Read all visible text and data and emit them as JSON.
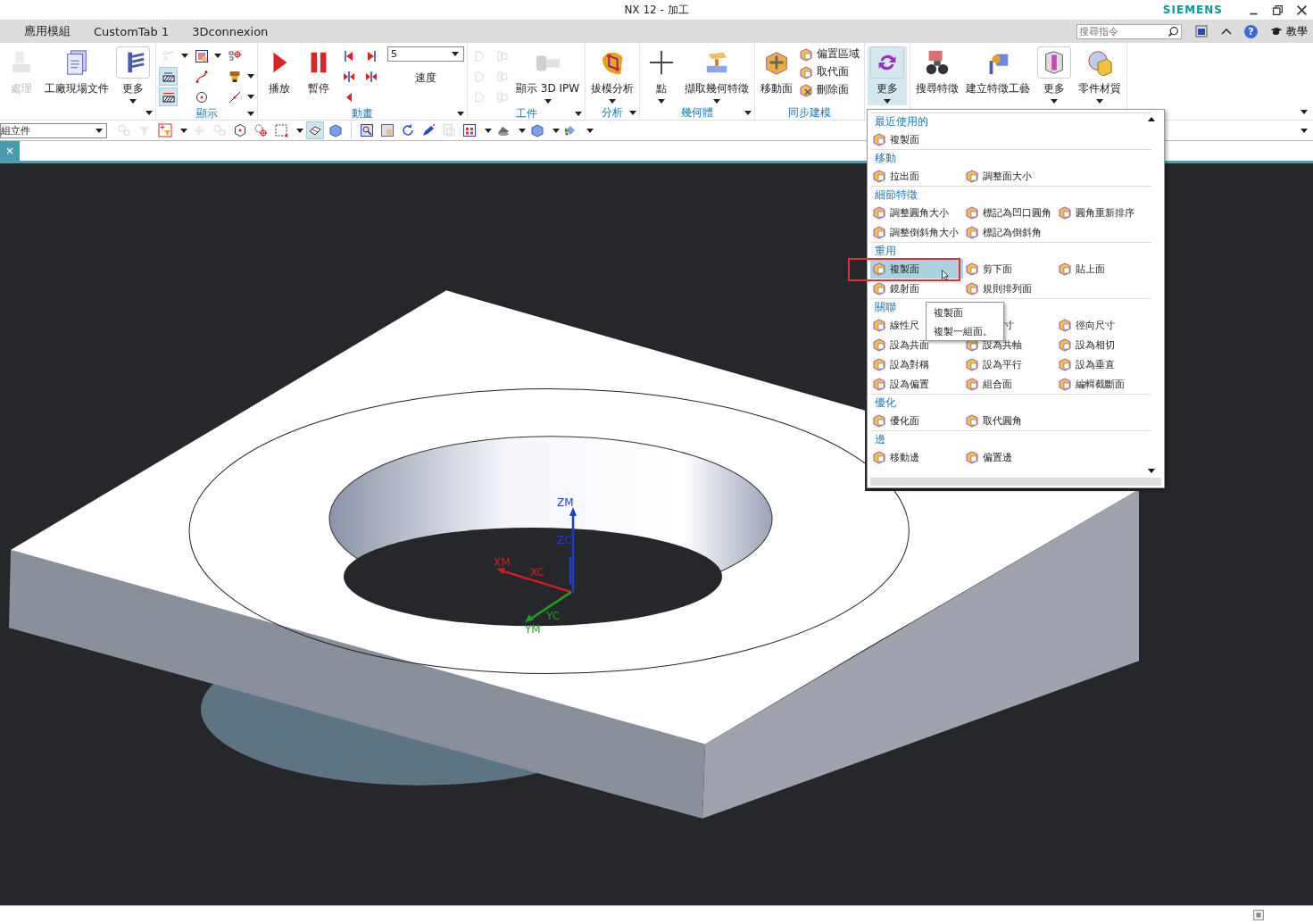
{
  "window": {
    "title": "NX 12 - 加工",
    "brand": "SIEMENS"
  },
  "menu_tabs": [
    {
      "label": "應用模組"
    },
    {
      "label": "CustomTab 1"
    },
    {
      "label": "3Dconnexion"
    }
  ],
  "search": {
    "placeholder": "搜尋指令"
  },
  "help": {
    "glyph": "?",
    "learn": "教學"
  },
  "ribbon": {
    "groups": [
      {
        "launcher": true,
        "items": [
          {
            "kind": "large",
            "label": "處理",
            "disabled": true,
            "dropdown": false,
            "expanded": false
          },
          {
            "kind": "large",
            "label": "工廠現場文件",
            "disabled": false,
            "dropdown": false,
            "expanded": false
          },
          {
            "kind": "large",
            "label": "更多",
            "disabled": false,
            "dropdown": true,
            "expanded": false
          }
        ]
      },
      {
        "label": "顯示",
        "launcher": true,
        "items": [
          {
            "kind": "icongrid",
            "columns": [
              [
                {
                  "disabled": true,
                  "on": false,
                  "dropdown": true
                },
                {
                  "disabled": false,
                  "on": true,
                  "dropdown": false
                },
                {
                  "disabled": false,
                  "on": true,
                  "dropdown": false
                }
              ],
              [
                {
                  "disabled": false,
                  "on": false,
                  "dropdown": true
                },
                {
                  "disabled": false,
                  "on": false,
                  "dropdown": false
                },
                {
                  "disabled": false,
                  "on": false,
                  "dropdown": false
                }
              ],
              [
                {
                  "disabled": false,
                  "on": false,
                  "dropdown": false
                },
                {
                  "disabled": false,
                  "on": false,
                  "dropdown": true
                },
                {
                  "disabled": false,
                  "on": false,
                  "dropdown": true
                }
              ]
            ]
          }
        ]
      },
      {
        "label": "動畫",
        "launcher": true,
        "items": [
          {
            "kind": "large",
            "label": "播放",
            "disabled": false,
            "dropdown": false,
            "expanded": false
          },
          {
            "kind": "large",
            "label": "暫停",
            "disabled": false,
            "dropdown": false,
            "expanded": false
          },
          {
            "kind": "icongrid",
            "columns": [
              [
                {
                  "disabled": false,
                  "on": false,
                  "dropdown": false
                },
                {
                  "disabled": false,
                  "on": false,
                  "dropdown": false
                },
                {
                  "disabled": false,
                  "on": false,
                  "dropdown": false
                }
              ],
              [
                {
                  "disabled": false,
                  "on": false,
                  "dropdown": false
                },
                {
                  "disabled": false,
                  "on": false,
                  "dropdown": false
                }
              ]
            ]
          },
          {
            "kind": "speed",
            "value": "5",
            "label": "速度"
          }
        ]
      },
      {
        "label": "工件",
        "launcher": true,
        "items": [
          {
            "kind": "icongrid",
            "columns": [
              [
                {
                  "disabled": true,
                  "on": false,
                  "dropdown": false
                },
                {
                  "disabled": true,
                  "on": false,
                  "dropdown": false
                },
                {
                  "disabled": true,
                  "on": false,
                  "dropdown": false
                }
              ],
              [
                {
                  "disabled": true,
                  "on": false,
                  "dropdown": false
                },
                {
                  "disabled": true,
                  "on": false,
                  "dropdown": false
                },
                {
                  "disabled": true,
                  "on": false,
                  "dropdown": false
                }
              ]
            ]
          },
          {
            "kind": "large",
            "label": "顯示 3D IPW",
            "disabled": false,
            "dropdown": true,
            "expanded": false
          }
        ]
      },
      {
        "label": "分析",
        "launcher": true,
        "items": [
          {
            "kind": "large",
            "label": "拔模分析",
            "disabled": false,
            "dropdown": true,
            "expanded": false
          }
        ]
      },
      {
        "label": "幾何體",
        "launcher": true,
        "items": [
          {
            "kind": "large",
            "label": "點",
            "disabled": false,
            "dropdown": true,
            "expanded": false
          },
          {
            "kind": "large",
            "label": "擷取幾何特徵",
            "disabled": false,
            "dropdown": true,
            "expanded": false
          }
        ]
      },
      {
        "label": "同步建模",
        "items": [
          {
            "kind": "large",
            "label": "移動面",
            "disabled": false,
            "dropdown": false,
            "expanded": false
          },
          {
            "kind": "stack",
            "items": [
              {
                "label": "偏置區域"
              },
              {
                "label": "取代面"
              },
              {
                "label": "刪除面"
              }
            ]
          }
        ]
      },
      {
        "items": [
          {
            "kind": "large",
            "label": "更多",
            "disabled": false,
            "dropdown": true,
            "expanded": true
          }
        ]
      },
      {
        "items": [
          {
            "kind": "large",
            "label": "搜尋特徵",
            "disabled": false,
            "dropdown": false,
            "expanded": false
          },
          {
            "kind": "large",
            "label": "建立特徵工藝",
            "disabled": false,
            "dropdown": false,
            "expanded": false
          },
          {
            "kind": "large",
            "label": "更多",
            "disabled": false,
            "dropdown": true,
            "expanded": false
          },
          {
            "kind": "large",
            "label": "零件材質",
            "disabled": false,
            "dropdown": true,
            "expanded": false
          }
        ]
      }
    ]
  },
  "toolbar": {
    "selection_filter": "組立件",
    "tools": [
      {
        "disabled": true,
        "on": false,
        "dropdown": false
      },
      {
        "disabled": true,
        "on": false,
        "dropdown": false
      },
      {
        "disabled": false,
        "on": false,
        "dropdown": true
      },
      {
        "disabled": true,
        "on": false,
        "dropdown": false
      },
      {
        "disabled": true,
        "on": false,
        "dropdown": false
      },
      {
        "disabled": false,
        "on": false,
        "dropdown": false
      },
      {
        "disabled": false,
        "on": false,
        "dropdown": false
      },
      {
        "disabled": false,
        "on": false,
        "dropdown": true
      },
      {
        "disabled": false,
        "on": true,
        "dropdown": false
      },
      {
        "disabled": false,
        "on": false,
        "dropdown": false
      },
      {
        "disabled": false,
        "on": false,
        "dropdown": false
      },
      {
        "disabled": false,
        "on": false,
        "dropdown": false
      },
      {
        "disabled": false,
        "on": false,
        "dropdown": false
      },
      {
        "disabled": false,
        "on": false,
        "dropdown": false
      },
      {
        "disabled": true,
        "on": false,
        "dropdown": false
      },
      {
        "disabled": false,
        "on": false,
        "dropdown": true
      },
      {
        "disabled": false,
        "on": false,
        "dropdown": true
      },
      {
        "disabled": false,
        "on": false,
        "dropdown": true
      },
      {
        "disabled": false,
        "on": false,
        "dropdown": true
      }
    ]
  },
  "viewport": {
    "axis_labels": [
      {
        "text": "ZM",
        "color": "#1a3fd0"
      },
      {
        "text": "ZC",
        "color": "#1a3fd0"
      },
      {
        "text": "XM",
        "color": "#d02020"
      },
      {
        "text": "XC",
        "color": "#d02020"
      },
      {
        "text": "YC",
        "color": "#20a020"
      },
      {
        "text": "YM",
        "color": "#20a020"
      }
    ]
  },
  "flyout": {
    "sections": [
      {
        "title": "最近使用的",
        "items": [
          {
            "kind": "entry",
            "label": "複製面",
            "selected": false
          }
        ]
      },
      {
        "title": "移動",
        "items": [
          {
            "kind": "entry",
            "label": "拉出面",
            "selected": false
          },
          {
            "kind": "entry",
            "label": "調整面大小",
            "selected": false
          }
        ]
      },
      {
        "title": "細節特徵",
        "items": [
          {
            "kind": "entry",
            "label": "調整圓角大小",
            "selected": false
          },
          {
            "kind": "entry",
            "label": "標記為凹口圓角",
            "selected": false
          },
          {
            "kind": "entry",
            "label": "圓角重新排序",
            "selected": false
          },
          {
            "kind": "entry",
            "label": "調整倒斜角大小",
            "selected": false
          },
          {
            "kind": "entry",
            "label": "標記為倒斜角",
            "selected": false
          }
        ]
      },
      {
        "title": "重用",
        "items": [
          {
            "kind": "entry",
            "label": "複製面",
            "selected": true
          },
          {
            "kind": "entry",
            "label": "剪下面",
            "selected": false
          },
          {
            "kind": "entry",
            "label": "貼上面",
            "selected": false
          },
          {
            "kind": "entry",
            "label": "鏡射面",
            "selected": false
          },
          {
            "kind": "entry",
            "label": "規則排列面",
            "selected": false
          }
        ]
      },
      {
        "title": "關聯",
        "items": [
          {
            "kind": "entry",
            "label": "線性尺",
            "selected": false
          },
          {
            "kind": "fragment",
            "label": "寸",
            "selected": false
          },
          {
            "kind": "entry",
            "label": "徑向尺寸",
            "selected": false
          },
          {
            "kind": "entry",
            "label": "設為共面",
            "selected": false
          },
          {
            "kind": "entry",
            "label": "設為共軸",
            "selected": false
          },
          {
            "kind": "entry",
            "label": "設為相切",
            "selected": false
          },
          {
            "kind": "entry",
            "label": "設為對稱",
            "selected": false
          },
          {
            "kind": "entry",
            "label": "設為平行",
            "selected": false
          },
          {
            "kind": "entry",
            "label": "設為垂直",
            "selected": false
          },
          {
            "kind": "entry",
            "label": "設為偏置",
            "selected": false
          },
          {
            "kind": "entry",
            "label": "組合面",
            "selected": false
          },
          {
            "kind": "entry",
            "label": "編輯截斷面",
            "selected": false
          }
        ]
      },
      {
        "title": "優化",
        "items": [
          {
            "kind": "entry",
            "label": "優化面",
            "selected": false
          },
          {
            "kind": "entry",
            "label": "取代圓角",
            "selected": false
          }
        ]
      },
      {
        "title": "邊",
        "items": [
          {
            "kind": "entry",
            "label": "移動邊",
            "selected": false
          },
          {
            "kind": "entry",
            "label": "偏置邊",
            "selected": false
          }
        ]
      }
    ],
    "tooltip": {
      "title": "複製面",
      "text": "複製一組面。"
    }
  }
}
